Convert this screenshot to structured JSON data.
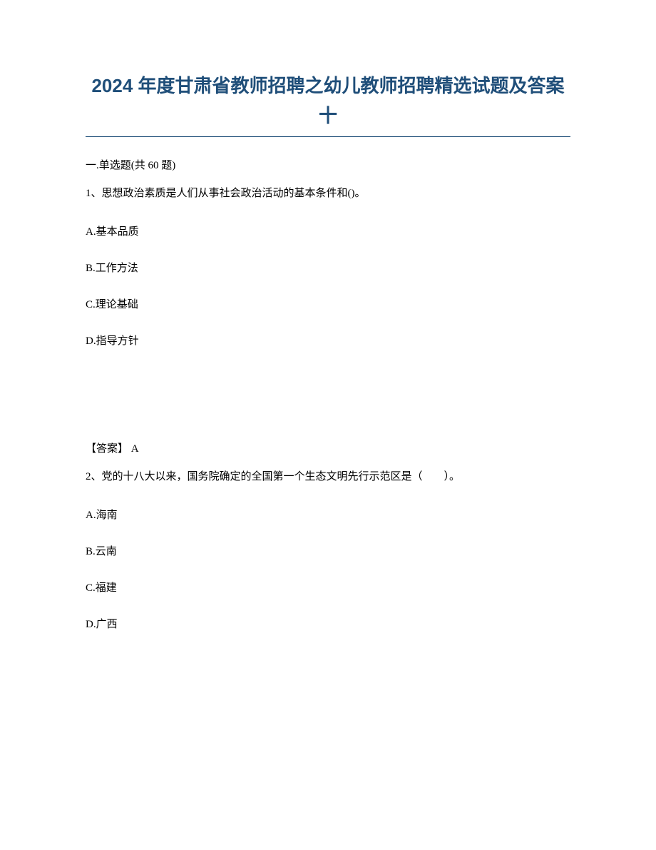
{
  "title": "2024 年度甘肃省教师招聘之幼儿教师招聘精选试题及答案十",
  "sectionHeader": "一.单选题(共 60 题)",
  "q1": {
    "text": "1、思想政治素质是人们从事社会政治活动的基本条件和()。",
    "optA": "A.基本品质",
    "optB": "B.工作方法",
    "optC": "C.理论基础",
    "optD": "D.指导方针",
    "answer": "【答案】 A"
  },
  "q2": {
    "text": "2、党的十八大以来，国务院确定的全国第一个生态文明先行示范区是（　　）。",
    "optA": "A.海南",
    "optB": "B.云南",
    "optC": "C.福建",
    "optD": "D.广西"
  }
}
